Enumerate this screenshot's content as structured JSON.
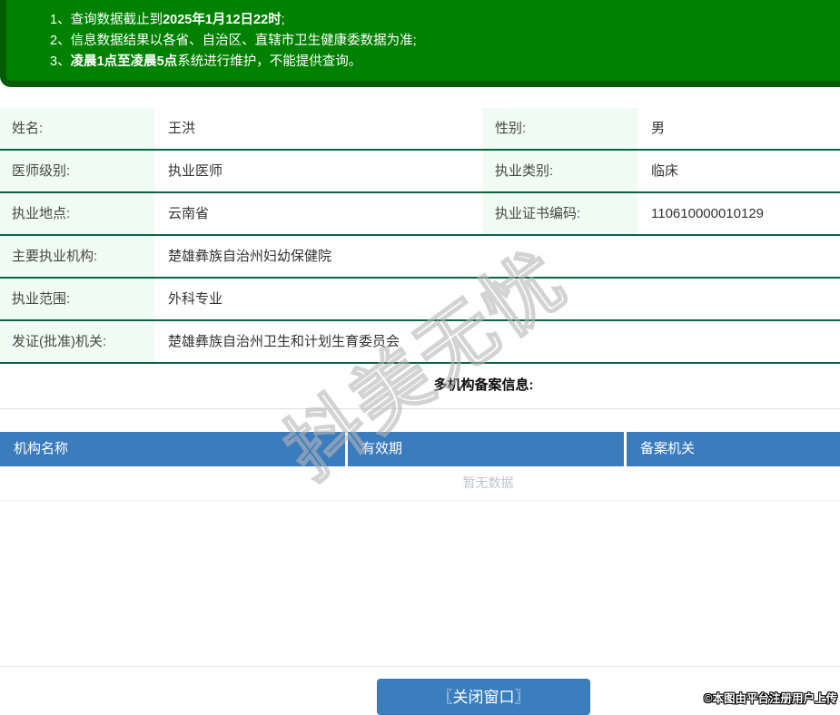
{
  "notice": {
    "lines": [
      {
        "num": "1、",
        "pre": "查询数据截止到",
        "bold": "2025年1月12日22时",
        "post": ";"
      },
      {
        "num": "2、",
        "pre": "信息数据结果以各省、自治区、直辖市卫生健康委数据为准;",
        "bold": "",
        "post": ""
      },
      {
        "num": "3、",
        "pre": "",
        "bold": "凌晨1点至凌晨5点",
        "post": "系统进行维护，不能提供查询。"
      }
    ]
  },
  "info": {
    "rows": [
      {
        "l1": "姓名:",
        "v1": "王洪",
        "l2": "性别:",
        "v2": "男"
      },
      {
        "l1": "医师级别:",
        "v1": "执业医师",
        "l2": "执业类别:",
        "v2": "临床"
      },
      {
        "l1": "执业地点:",
        "v1": "云南省",
        "l2": "执业证书编码:",
        "v2": "110610000010129"
      },
      {
        "l1": "主要执业机构:",
        "v1": "楚雄彝族自治州妇幼保健院"
      },
      {
        "l1": "执业范围:",
        "v1": "外科专业"
      },
      {
        "l1": "发证(批准)机关:",
        "v1": "楚雄彝族自治州卫生和计划生育委员会"
      }
    ]
  },
  "filing": {
    "title": "多机构备案信息:",
    "columns": [
      "机构名称",
      "有效期",
      "备案机关"
    ],
    "empty_text": "暂无数据"
  },
  "footer": {
    "close_button": "〖关闭窗口〗",
    "copyright": "©本图由平台注册用户上传"
  },
  "watermark": "抖美无忧",
  "colors": {
    "banner_green": "#018101",
    "banner_border_green": "#025c02",
    "row_border_green": "#0a6447",
    "label_bg": "#effbf4",
    "table_header_blue": "#3a7cbe",
    "button_blue": "#3a7ebd",
    "empty_text_gray": "#c0c4cc"
  }
}
